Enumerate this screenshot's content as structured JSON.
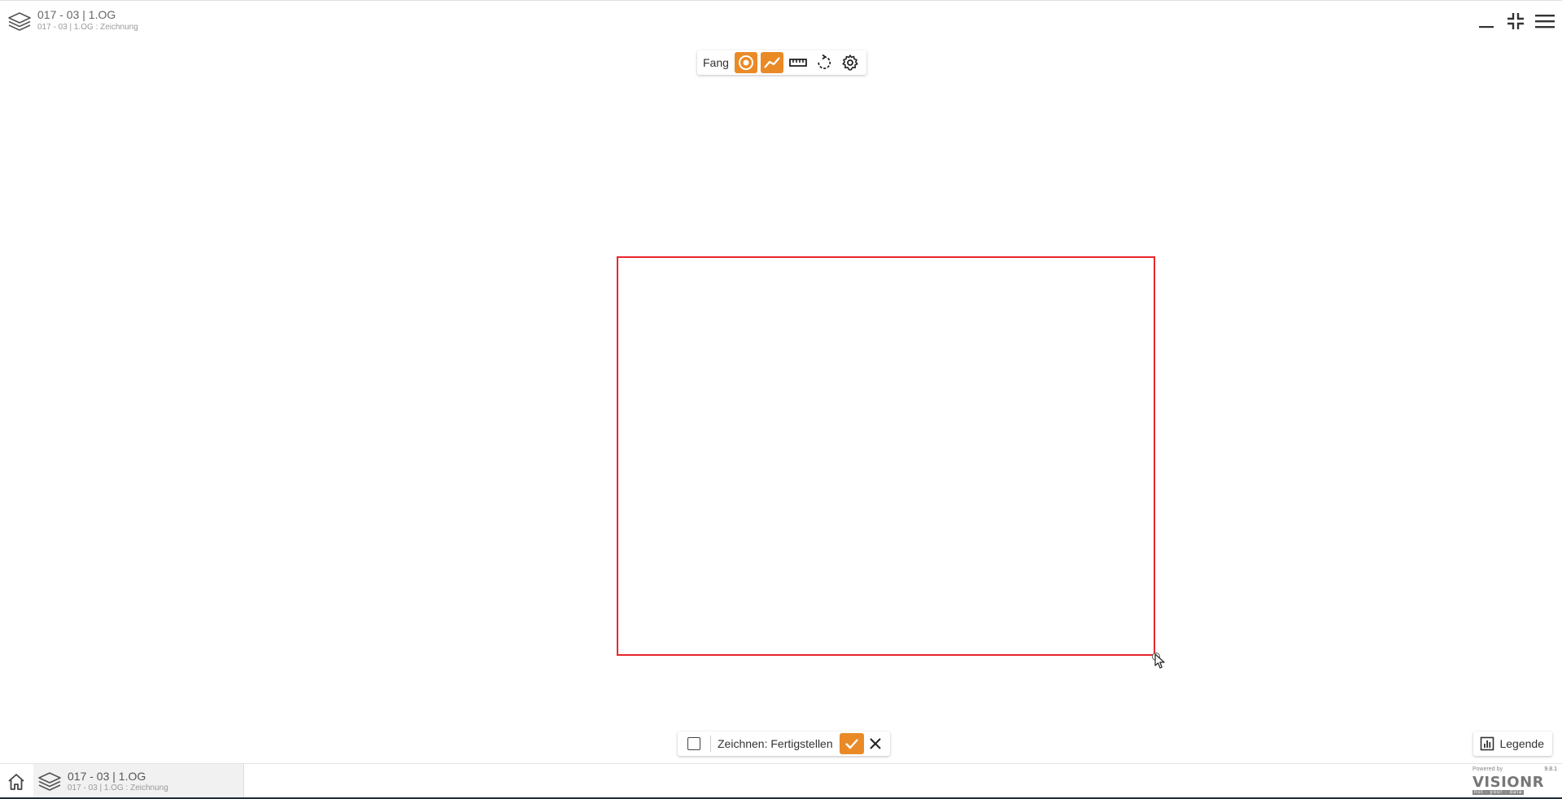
{
  "header": {
    "title": "017 - 03 | 1.OG",
    "subtitle": "017 - 03 | 1.OG : Zeichnung",
    "icon": "layers-icon"
  },
  "window_controls": {
    "minimize_icon": "minimize-icon",
    "collapse_icon": "collapse-fullscreen-icon",
    "menu_icon": "hamburger-menu-icon"
  },
  "snap_toolbar": {
    "label": "Fang",
    "buttons": [
      {
        "icon": "snap-point-icon",
        "active": true
      },
      {
        "icon": "snap-line-icon",
        "active": true
      },
      {
        "icon": "ruler-icon",
        "active": false
      },
      {
        "icon": "rotate-icon",
        "active": false
      },
      {
        "icon": "gear-icon",
        "active": false
      }
    ],
    "accent_color": "#ea8a26"
  },
  "drawing": {
    "shape_color": "#e8262c"
  },
  "draw_bar": {
    "label": "Zeichnen: Fertigstellen",
    "confirm_icon": "check-icon",
    "cancel_icon": "close-icon"
  },
  "legend": {
    "label": "Legende",
    "icon": "bar-chart-icon"
  },
  "footer": {
    "home_icon": "home-icon",
    "tab_title": "017 - 03 | 1.OG",
    "tab_subtitle": "017 - 03 | 1.OG : Zeichnung",
    "brand_powered": "Powered by",
    "brand_version": "9.8.1",
    "brand_name": "VISIONR",
    "brand_tagline": "not · your · data"
  }
}
